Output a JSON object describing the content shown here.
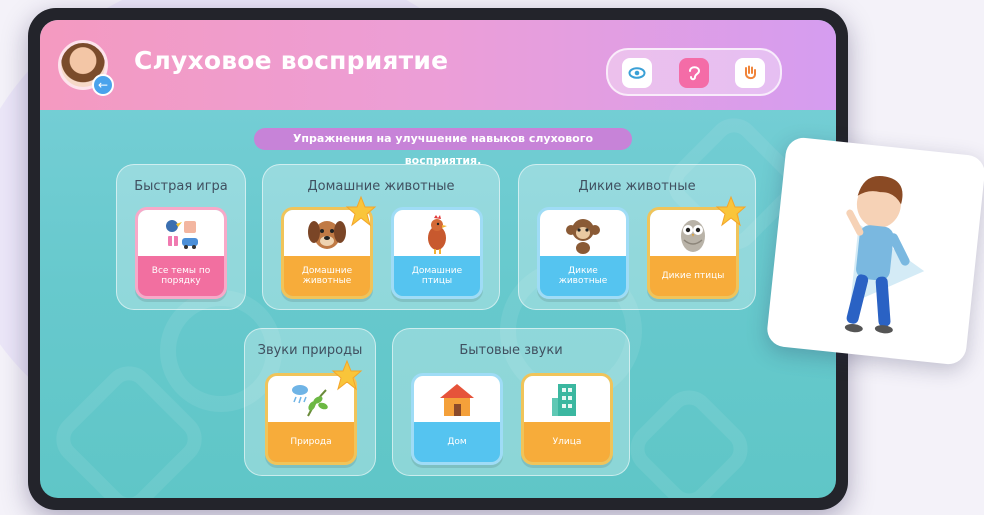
{
  "header": {
    "title": "Слуховое восприятие",
    "back_icon": "arrow-left-icon",
    "modes": [
      {
        "name": "eye-icon",
        "active": false
      },
      {
        "name": "ear-icon",
        "active": true
      },
      {
        "name": "hand-icon",
        "active": false
      }
    ]
  },
  "subtitle": "Упражнения на улучшение навыков слухового восприятия.",
  "groups": {
    "quick": {
      "title": "Быстрая игра",
      "cards": [
        {
          "label": "Все темы по порядку",
          "color": "pink",
          "icon": "mixed-toys-icon"
        }
      ]
    },
    "pets": {
      "title": "Домашние животные",
      "cards": [
        {
          "label": "Домашние животные",
          "color": "orange",
          "icon": "dog-icon"
        },
        {
          "label": "Домашние птицы",
          "color": "blue",
          "icon": "rooster-icon"
        }
      ]
    },
    "wild": {
      "title": "Дикие животные",
      "cards": [
        {
          "label": "Дикие животные",
          "color": "blue",
          "icon": "monkey-icon"
        },
        {
          "label": "Дикие птицы",
          "color": "orange",
          "icon": "owl-icon"
        }
      ]
    },
    "nature": {
      "title": "Звуки природы",
      "cards": [
        {
          "label": "Природа",
          "color": "orange",
          "icon": "rain-branch-icon"
        }
      ]
    },
    "household": {
      "title": "Бытовые звуки",
      "cards": [
        {
          "label": "Дом",
          "color": "blue",
          "icon": "house-icon"
        },
        {
          "label": "Улица",
          "color": "orange",
          "icon": "building-icon"
        }
      ]
    }
  },
  "colors": {
    "header_start": "#f49ac0",
    "header_end": "#d59df0",
    "screen_bg": "#67c9cd",
    "subtitle_bg": "#c783d8",
    "pink": "#f26fa0",
    "orange": "#f7ac3a",
    "blue": "#55c4f0",
    "star": "#f9c53a"
  }
}
